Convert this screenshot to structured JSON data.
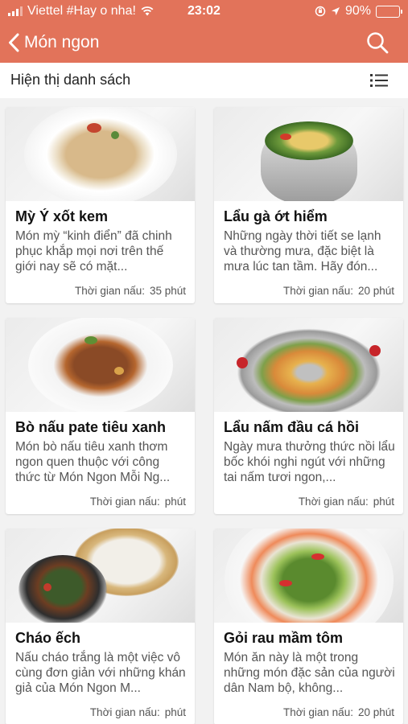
{
  "status": {
    "carrier": "Viettel #Hay o nha!",
    "time": "23:02",
    "battery": "90%",
    "battery_level": 0.9
  },
  "nav": {
    "title": "Món ngon"
  },
  "toolbar": {
    "title": "Hiện thị danh sách"
  },
  "colors": {
    "accent": "#e2735a"
  },
  "recipes": [
    {
      "title": "Mỳ Ý xốt kem",
      "desc": "Món mỳ “kinh điển” đã chinh phục khắp mọi nơi trên thế giới nay sẽ có mặt...",
      "time_label": "Thời gian nấu:",
      "time_value": "35 phút"
    },
    {
      "title": "Lẩu gà ớt hiểm",
      "desc": "Những ngày thời tiết se lạnh và thường mưa, đặc biệt là mưa lúc tan tầm. Hãy đón...",
      "time_label": "Thời gian nấu:",
      "time_value": "20 phút"
    },
    {
      "title": "Bò nấu pate tiêu xanh",
      "desc": "Món bò nấu tiêu xanh thơm ngon quen thuộc với công thức từ Món Ngon Mỗi Ng...",
      "time_label": "Thời gian nấu:",
      "time_value": "phút"
    },
    {
      "title": "Lẩu nấm đầu cá hồi",
      "desc": "Ngày mưa thưởng thức nồi lẩu bốc khói nghi ngút với những tai nấm tươi ngon,...",
      "time_label": "Thời gian nấu:",
      "time_value": "phút"
    },
    {
      "title": "Cháo ếch",
      "desc": "Nấu cháo trắng là một việc vô cùng đơn giản với những khán giả của Món Ngon M...",
      "time_label": "Thời gian nấu:",
      "time_value": "phút"
    },
    {
      "title": "Gỏi rau mầm tôm",
      "desc": "Món ăn này là một trong những món đặc sản của người dân Nam bộ, không...",
      "time_label": "Thời gian nấu:",
      "time_value": "20 phút"
    }
  ]
}
